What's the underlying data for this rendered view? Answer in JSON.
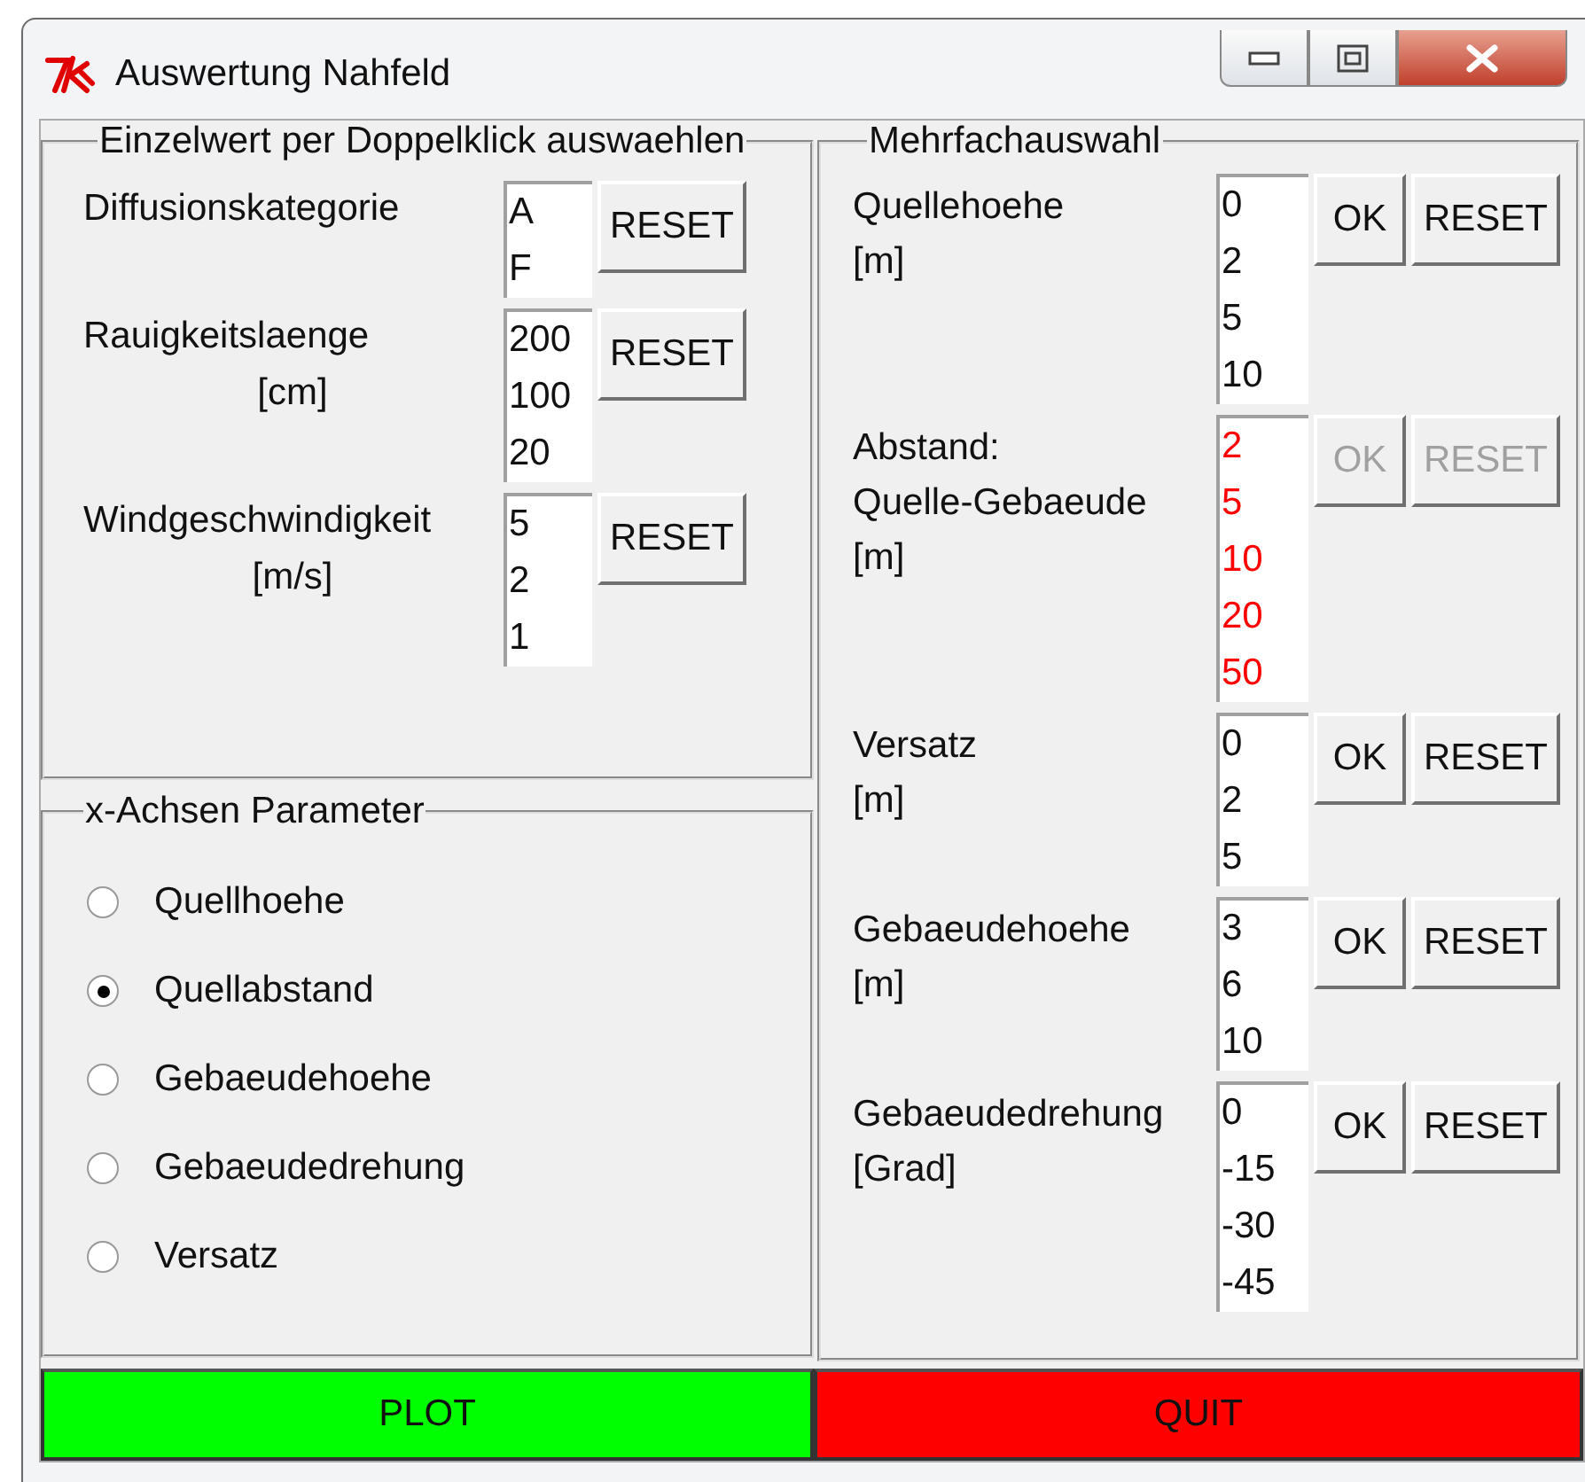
{
  "window": {
    "title": "Auswertung Nahfeld"
  },
  "single_select": {
    "title": "Einzelwert per Doppelklick auswaehlen",
    "groups": [
      {
        "label": [
          "Diffusionskategorie"
        ],
        "values": [
          "A",
          "F"
        ],
        "reset": "RESET"
      },
      {
        "label": [
          "Rauigkeitslaenge",
          "[cm]"
        ],
        "values": [
          "200",
          "100",
          "20"
        ],
        "reset": "RESET"
      },
      {
        "label": [
          "Windgeschwindigkeit",
          "[m/s]"
        ],
        "values": [
          "5",
          "2",
          "1"
        ],
        "reset": "RESET"
      }
    ]
  },
  "x_axis": {
    "title": "x-Achsen Parameter",
    "options": [
      {
        "label": "Quellhoehe",
        "selected": false
      },
      {
        "label": "Quellabstand",
        "selected": true
      },
      {
        "label": "Gebaeudehoehe",
        "selected": false
      },
      {
        "label": "Gebaeudedrehung",
        "selected": false
      },
      {
        "label": "Versatz",
        "selected": false
      }
    ]
  },
  "multi_select": {
    "title": "Mehrfachauswahl",
    "groups": [
      {
        "label": [
          "Quellehoehe",
          "[m]"
        ],
        "values": [
          "0",
          "2",
          "5",
          "10"
        ],
        "ok": "OK",
        "reset": "RESET",
        "disabled": false
      },
      {
        "label": [
          "Abstand:",
          "Quelle-Gebaeude",
          "[m]"
        ],
        "values": [
          "2",
          "5",
          "10",
          "20",
          "50"
        ],
        "ok": "OK",
        "reset": "RESET",
        "disabled": true
      },
      {
        "label": [
          "Versatz",
          "[m]"
        ],
        "values": [
          "0",
          "2",
          "5"
        ],
        "ok": "OK",
        "reset": "RESET",
        "disabled": false
      },
      {
        "label": [
          "Gebaeudehoehe",
          "[m]"
        ],
        "values": [
          "3",
          "6",
          "10"
        ],
        "ok": "OK",
        "reset": "RESET",
        "disabled": false
      },
      {
        "label": [
          "Gebaeudedrehung",
          "[Grad]"
        ],
        "values": [
          "0",
          "-15",
          "-30",
          "-45"
        ],
        "ok": "OK",
        "reset": "RESET",
        "disabled": false
      }
    ]
  },
  "actions": [
    {
      "label": "PLOT",
      "kind": "go"
    },
    {
      "label": "QUIT",
      "kind": "stop"
    }
  ]
}
